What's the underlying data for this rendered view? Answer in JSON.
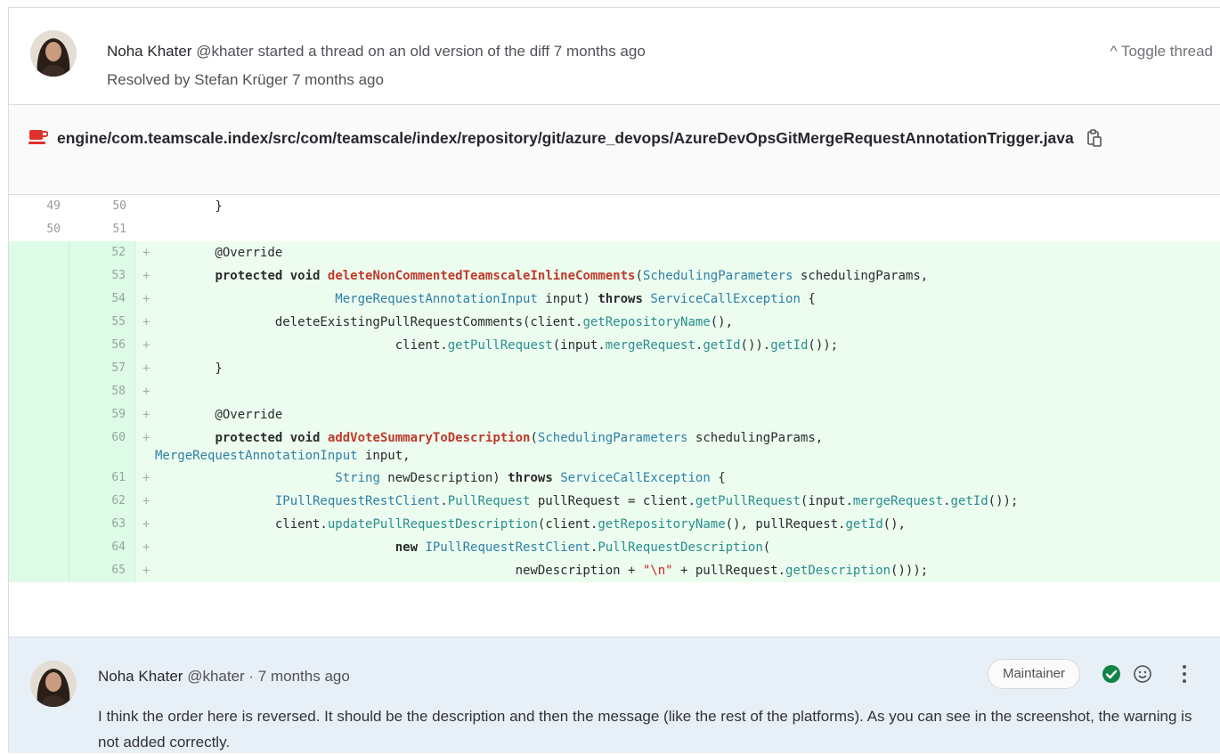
{
  "thread": {
    "author_name": "Noha Khater",
    "author_handle": "@khater",
    "action_text": "started a thread on an old version of the diff 7 months ago",
    "resolved_prefix": "Resolved by",
    "resolved_by": "Stefan Krüger",
    "resolved_time": "7 months ago",
    "toggle_label": "^ Toggle thread"
  },
  "file": {
    "path": "engine/com.teamscale.index/src/com/teamscale/index/repository/git/azure_devops/AzureDevOpsGitMergeRequestAnnotationTrigger.java",
    "icon": "java-coffee-icon",
    "copy_icon": "copy-clipboard-icon"
  },
  "diff_lines": [
    {
      "old": "49",
      "new": "50",
      "type": "context",
      "code": "        }"
    },
    {
      "old": "50",
      "new": "51",
      "type": "context",
      "code": ""
    },
    {
      "old": "",
      "new": "52",
      "type": "add",
      "code": "        @Override"
    },
    {
      "old": "",
      "new": "53",
      "type": "add",
      "code": "        protected void deleteNonCommentedTeamscaleInlineComments(SchedulingParameters schedulingParams,"
    },
    {
      "old": "",
      "new": "54",
      "type": "add",
      "code": "                        MergeRequestAnnotationInput input) throws ServiceCallException {"
    },
    {
      "old": "",
      "new": "55",
      "type": "add",
      "code": "                deleteExistingPullRequestComments(client.getRepositoryName(),"
    },
    {
      "old": "",
      "new": "56",
      "type": "add",
      "code": "                                client.getPullRequest(input.mergeRequest.getId()).getId());"
    },
    {
      "old": "",
      "new": "57",
      "type": "add",
      "code": "        }"
    },
    {
      "old": "",
      "new": "58",
      "type": "add",
      "code": ""
    },
    {
      "old": "",
      "new": "59",
      "type": "add",
      "code": "        @Override"
    },
    {
      "old": "",
      "new": "60",
      "type": "add",
      "code": "        protected void addVoteSummaryToDescription(SchedulingParameters schedulingParams,\nMergeRequestAnnotationInput input,"
    },
    {
      "old": "",
      "new": "61",
      "type": "add",
      "code": "                        String newDescription) throws ServiceCallException {"
    },
    {
      "old": "",
      "new": "62",
      "type": "add",
      "code": "                IPullRequestRestClient.PullRequest pullRequest = client.getPullRequest(input.mergeRequest.getId());"
    },
    {
      "old": "",
      "new": "63",
      "type": "add",
      "code": "                client.updatePullRequestDescription(client.getRepositoryName(), pullRequest.getId(),"
    },
    {
      "old": "",
      "new": "64",
      "type": "add",
      "code": "                                new IPullRequestRestClient.PullRequestDescription("
    },
    {
      "old": "",
      "new": "65",
      "type": "add",
      "code": "                                                newDescription + \"\\n\" + pullRequest.getDescription()));"
    }
  ],
  "comment": {
    "author_name": "Noha Khater",
    "meta": "@khater · 7 months ago",
    "role": "Maintainer",
    "body": "I think the order here is reversed. It should be the description and then the message (like the rest of the platforms). As you can see in the screenshot, the warning is not added correctly.",
    "resolved_icon": "check-circle-icon",
    "emoji_icon": "smiley-icon",
    "more_icon": "more-vertical-icon"
  },
  "colors": {
    "added_bg": "#ecfdf0",
    "added_gutter": "#ddfbe6",
    "comment_bg": "#e8f0f7",
    "resolved_green": "#108548"
  }
}
